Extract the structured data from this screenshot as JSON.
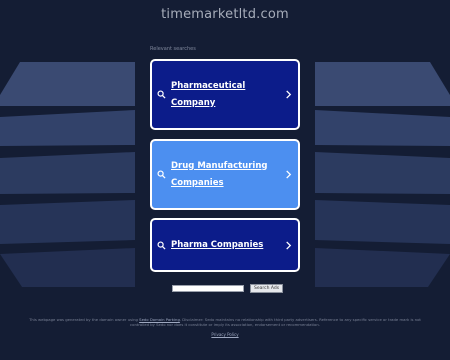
{
  "header": {
    "domain": "timemarketltd.com"
  },
  "related": {
    "label": "Relevant searches"
  },
  "cards": [
    {
      "line1": "Pharmaceutical",
      "line2": "Company",
      "style": "dark",
      "icon": "search-icon"
    },
    {
      "line1": "Drug Manufacturing",
      "line2": "Companies",
      "style": "light",
      "icon": "search-icon"
    },
    {
      "line1": "Pharma Companies",
      "line2": "",
      "style": "dark",
      "icon": "search-icon"
    }
  ],
  "search": {
    "button_label": "Search Ads",
    "placeholder": ""
  },
  "footer": {
    "disclaimer_part1": "This webpage was generated by the domain owner using ",
    "disclaimer_link": "Sedo Domain Parking",
    "disclaimer_part2": ". Disclaimer: Sedo maintains no relationship with third party advertisers. Reference to any specific service or trade mark is not controlled by Sedo nor does it constitute or imply its association, endorsement or recommendation.",
    "privacy": "Privacy Policy"
  },
  "colors": {
    "background": "#141d34",
    "card_dark": "#0c1c8a",
    "card_light": "#4c8ff0"
  }
}
